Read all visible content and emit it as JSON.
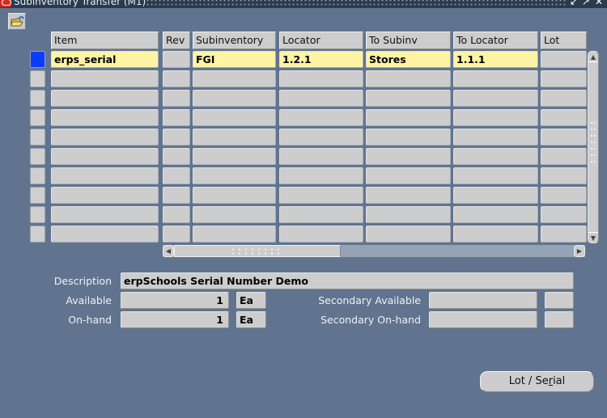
{
  "window": {
    "title": "Subinventory Transfer (M1)",
    "controls": [
      "minimize-icon",
      "maximize-icon",
      "close-icon"
    ]
  },
  "toolbar": {
    "open_icon": "open-folder-icon"
  },
  "table": {
    "columns": [
      "Item",
      "Rev",
      "Subinventory",
      "Locator",
      "To Subinv",
      "To Locator",
      "Lot"
    ],
    "rows": [
      {
        "item": "erps_serial",
        "rev": "",
        "subinventory": "FGI",
        "locator": "1.2.1",
        "to_subinv": "Stores",
        "to_locator": "1.1.1",
        "lot": ""
      },
      {
        "item": "",
        "rev": "",
        "subinventory": "",
        "locator": "",
        "to_subinv": "",
        "to_locator": "",
        "lot": ""
      },
      {
        "item": "",
        "rev": "",
        "subinventory": "",
        "locator": "",
        "to_subinv": "",
        "to_locator": "",
        "lot": ""
      },
      {
        "item": "",
        "rev": "",
        "subinventory": "",
        "locator": "",
        "to_subinv": "",
        "to_locator": "",
        "lot": ""
      },
      {
        "item": "",
        "rev": "",
        "subinventory": "",
        "locator": "",
        "to_subinv": "",
        "to_locator": "",
        "lot": ""
      },
      {
        "item": "",
        "rev": "",
        "subinventory": "",
        "locator": "",
        "to_subinv": "",
        "to_locator": "",
        "lot": ""
      },
      {
        "item": "",
        "rev": "",
        "subinventory": "",
        "locator": "",
        "to_subinv": "",
        "to_locator": "",
        "lot": ""
      },
      {
        "item": "",
        "rev": "",
        "subinventory": "",
        "locator": "",
        "to_subinv": "",
        "to_locator": "",
        "lot": ""
      },
      {
        "item": "",
        "rev": "",
        "subinventory": "",
        "locator": "",
        "to_subinv": "",
        "to_locator": "",
        "lot": ""
      },
      {
        "item": "",
        "rev": "",
        "subinventory": "",
        "locator": "",
        "to_subinv": "",
        "to_locator": "",
        "lot": ""
      }
    ],
    "current_row": 0
  },
  "details": {
    "description_label": "Description",
    "description_value": "erpSchools Serial Number Demo",
    "available_label": "Available",
    "available_value": "1",
    "available_uom": "Ea",
    "onhand_label": "On-hand",
    "onhand_value": "1",
    "onhand_uom": "Ea",
    "secondary_available_label": "Secondary Available",
    "secondary_available_value": "",
    "secondary_available_uom": "",
    "secondary_onhand_label": "Secondary On-hand",
    "secondary_onhand_value": "",
    "secondary_onhand_uom": ""
  },
  "buttons": {
    "lot_serial_pre": "Lot / Se",
    "lot_serial_mnemonic": "r",
    "lot_serial_post": "ial"
  },
  "colors": {
    "background": "#61748f",
    "current_record": "#0a3cff",
    "required_field": "#fff3a4"
  }
}
